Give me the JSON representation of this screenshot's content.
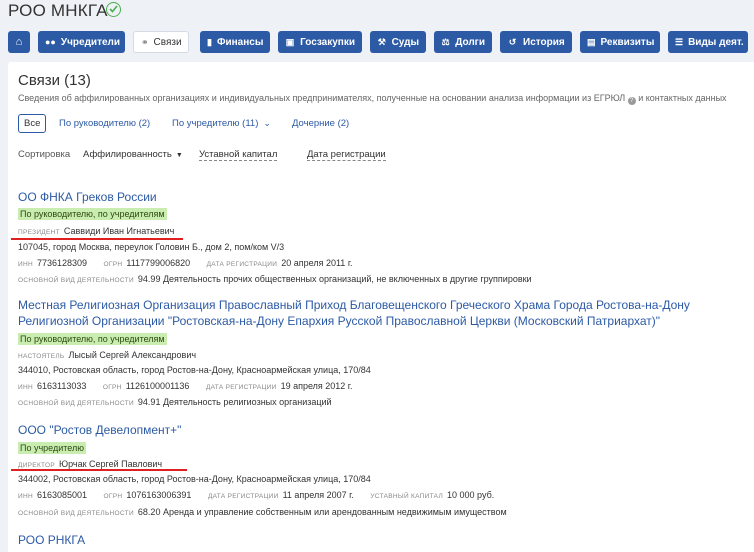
{
  "header": {
    "title": "РОО МНКГА",
    "accent": "#2c5aa5",
    "nav": [
      {
        "label": "",
        "icon": "home-icon"
      },
      {
        "label": "Учредители",
        "icon": "users-icon"
      },
      {
        "label": "Связи",
        "icon": "link-icon",
        "active": true
      },
      {
        "label": "Финансы",
        "icon": "chart-icon"
      },
      {
        "label": "Госзакупки",
        "icon": "procurement-icon"
      },
      {
        "label": "Суды",
        "icon": "gavel-icon"
      },
      {
        "label": "Долги",
        "icon": "scales-icon"
      },
      {
        "label": "История",
        "icon": "history-icon"
      },
      {
        "label": "Реквизиты",
        "icon": "document-icon"
      },
      {
        "label": "Виды деят.",
        "icon": "list-icon"
      }
    ]
  },
  "section": {
    "title": "Связи (13)",
    "description": "Сведения об аффилированных организациях и индивидуальных предпринимателях, полученные на основании анализа информации из ЕГРЮЛ",
    "description_tail": "и контактных данных",
    "filters": [
      "Все",
      "По руководителю (2)",
      "По учредителю (11)",
      "Дочерние (2)"
    ],
    "sort_label": "Сортировка",
    "sort_options": [
      "Аффилированность",
      "Уставной капитал",
      "Дата регистрации"
    ]
  },
  "labels": {
    "inn": "ИНН",
    "ogrn": "ОГРН",
    "reg_date": "ДАТА РЕГИСТРАЦИИ",
    "capital": "УСТАВНЫЙ КАПИТАЛ",
    "activity": "ОСНОВНОЙ ВИД ДЕЯТЕЛЬНОСТИ"
  },
  "entities": [
    {
      "name": "ОО ФНКА Греков России",
      "tag": "По руководителю, по учредителям",
      "role": "ПРЕЗИДЕНТ",
      "person": "Саввиди Иван Игнатьевич",
      "address": "107045, город Москва, переулок Головин Б., дом 2, пом/ком V/3",
      "inn": "7736128309",
      "ogrn": "1117799006820",
      "reg_date": "20 апреля 2011 г.",
      "activity": "94.99 Деятельность прочих общественных организаций, не включенных в другие группировки"
    },
    {
      "name_line1": "Местная Религиозная Организация Православный Приход Благовещенского Греческого Храма Города Ростова-на-Дону",
      "name_line2": "Религиозной Организации \"Ростовская-на-Дону Епархия Русской Православной Церкви (Московский Патриархат)\"",
      "tag": "По руководителю, по учредителям",
      "role": "НАСТОЯТЕЛЬ",
      "person": "Лысый Сергей Александрович",
      "address": "344010, Ростовская область, город Ростов-на-Дону, Красноармейская улица, 170/84",
      "inn": "6163113033",
      "ogrn": "1126100001136",
      "reg_date": "19 апреля 2012 г.",
      "activity": "94.91 Деятельность религиозных организаций"
    },
    {
      "name": "ООО \"Ростов Девелопмент+\"",
      "tag": "По учредителю",
      "role": "ДИРЕКТОР",
      "person": "Юрчак Сергей Павлович",
      "address": "344002, Ростовская область, город Ростов-на-Дону, Красноармейская улица, 170/84",
      "inn": "6163085001",
      "ogrn": "1076163006391",
      "reg_date": "11 апреля 2007 г.",
      "capital": "10 000 руб.",
      "activity": "68.20 Аренда и управление собственным или арендованным недвижимым имуществом"
    },
    {
      "name": "РОО РНКГА"
    }
  ]
}
